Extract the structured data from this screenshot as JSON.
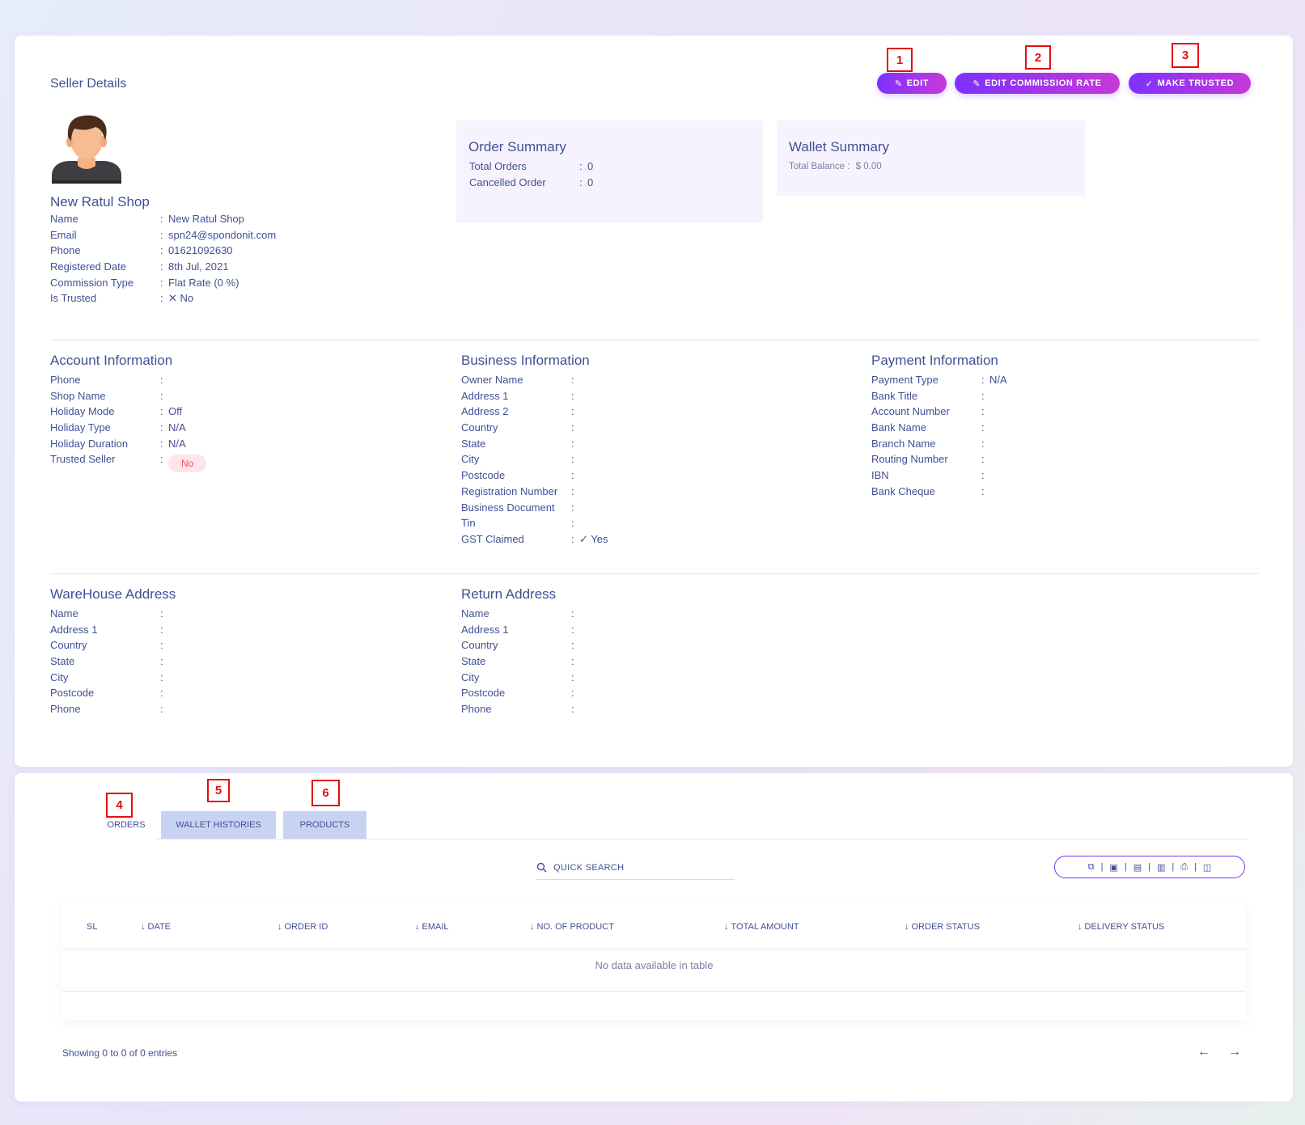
{
  "header": {
    "title": "Seller Details",
    "buttons": {
      "edit": "EDIT",
      "edit_commission": "EDIT COMMISSION RATE",
      "make_trusted": "MAKE TRUSTED"
    }
  },
  "annotations": [
    "1",
    "2",
    "3",
    "4",
    "5",
    "6"
  ],
  "shop": {
    "name": "New Ratul Shop",
    "fields": [
      {
        "label": "Name",
        "value": "New Ratul Shop"
      },
      {
        "label": "Email",
        "value": "spn24@spondonit.com"
      },
      {
        "label": "Phone",
        "value": "01621092630"
      },
      {
        "label": "Registered Date",
        "value": "8th Jul, 2021"
      },
      {
        "label": "Commission Type",
        "value": "Flat Rate (0 %)"
      },
      {
        "label": "Is Trusted",
        "value": "No"
      }
    ]
  },
  "order_summary": {
    "title": "Order Summary",
    "fields": [
      {
        "label": "Total Orders",
        "value": "0"
      },
      {
        "label": "Cancelled Order",
        "value": "0"
      }
    ]
  },
  "wallet_summary": {
    "title": "Wallet Summary",
    "label": "Total Balance :",
    "value": "$ 0.00"
  },
  "account_info": {
    "title": "Account Information",
    "fields": [
      {
        "label": "Phone",
        "value": ""
      },
      {
        "label": "Shop Name",
        "value": ""
      },
      {
        "label": "Holiday Mode",
        "value": "Off"
      },
      {
        "label": "Holiday Type",
        "value": "N/A"
      },
      {
        "label": "Holiday Duration",
        "value": "N/A"
      },
      {
        "label": "Trusted Seller",
        "value": "No"
      }
    ]
  },
  "business_info": {
    "title": "Business Information",
    "fields": [
      {
        "label": "Owner Name",
        "value": ""
      },
      {
        "label": "Address 1",
        "value": ""
      },
      {
        "label": "Address 2",
        "value": ""
      },
      {
        "label": "Country",
        "value": ""
      },
      {
        "label": "State",
        "value": ""
      },
      {
        "label": "City",
        "value": ""
      },
      {
        "label": "Postcode",
        "value": ""
      },
      {
        "label": "Registration Number",
        "value": ""
      },
      {
        "label": "Business Document",
        "value": ""
      },
      {
        "label": "Tin",
        "value": ""
      },
      {
        "label": "GST Claimed",
        "value": "Yes"
      }
    ]
  },
  "payment_info": {
    "title": "Payment Information",
    "fields": [
      {
        "label": "Payment Type",
        "value": "N/A"
      },
      {
        "label": "Bank Title",
        "value": ""
      },
      {
        "label": "Account Number",
        "value": ""
      },
      {
        "label": "Bank Name",
        "value": ""
      },
      {
        "label": "Branch Name",
        "value": ""
      },
      {
        "label": "Routing Number",
        "value": ""
      },
      {
        "label": "IBN",
        "value": ""
      },
      {
        "label": "Bank Cheque",
        "value": ""
      }
    ]
  },
  "warehouse": {
    "title": "WareHouse Address",
    "fields": [
      {
        "label": "Name",
        "value": ""
      },
      {
        "label": "Address 1",
        "value": ""
      },
      {
        "label": "Country",
        "value": ""
      },
      {
        "label": "State",
        "value": ""
      },
      {
        "label": "City",
        "value": ""
      },
      {
        "label": "Postcode",
        "value": ""
      },
      {
        "label": "Phone",
        "value": ""
      }
    ]
  },
  "return_address": {
    "title": "Return Address",
    "fields": [
      {
        "label": "Name",
        "value": ""
      },
      {
        "label": "Address 1",
        "value": ""
      },
      {
        "label": "Country",
        "value": ""
      },
      {
        "label": "State",
        "value": ""
      },
      {
        "label": "City",
        "value": ""
      },
      {
        "label": "Postcode",
        "value": ""
      },
      {
        "label": "Phone",
        "value": ""
      }
    ]
  },
  "tabs": {
    "orders": "ORDERS",
    "wallet_histories": "WALLET HISTORIES",
    "products": "PRODUCTS",
    "active": "orders"
  },
  "search": {
    "placeholder": "QUICK SEARCH"
  },
  "table": {
    "columns": [
      "SL",
      "DATE",
      "ORDER ID",
      "EMAIL",
      "NO. OF PRODUCT",
      "TOTAL AMOUNT",
      "ORDER STATUS",
      "DELIVERY STATUS"
    ],
    "empty_message": "No data available in table",
    "info": "Showing 0 to 0 of 0 entries"
  },
  "colors": {
    "accent": "#7c32ff",
    "accent2": "#c738d8",
    "text": "#415094",
    "summary_bg": "#f6f3fe",
    "badge_bg": "#fde6ea",
    "badge_text": "#f0506e"
  }
}
